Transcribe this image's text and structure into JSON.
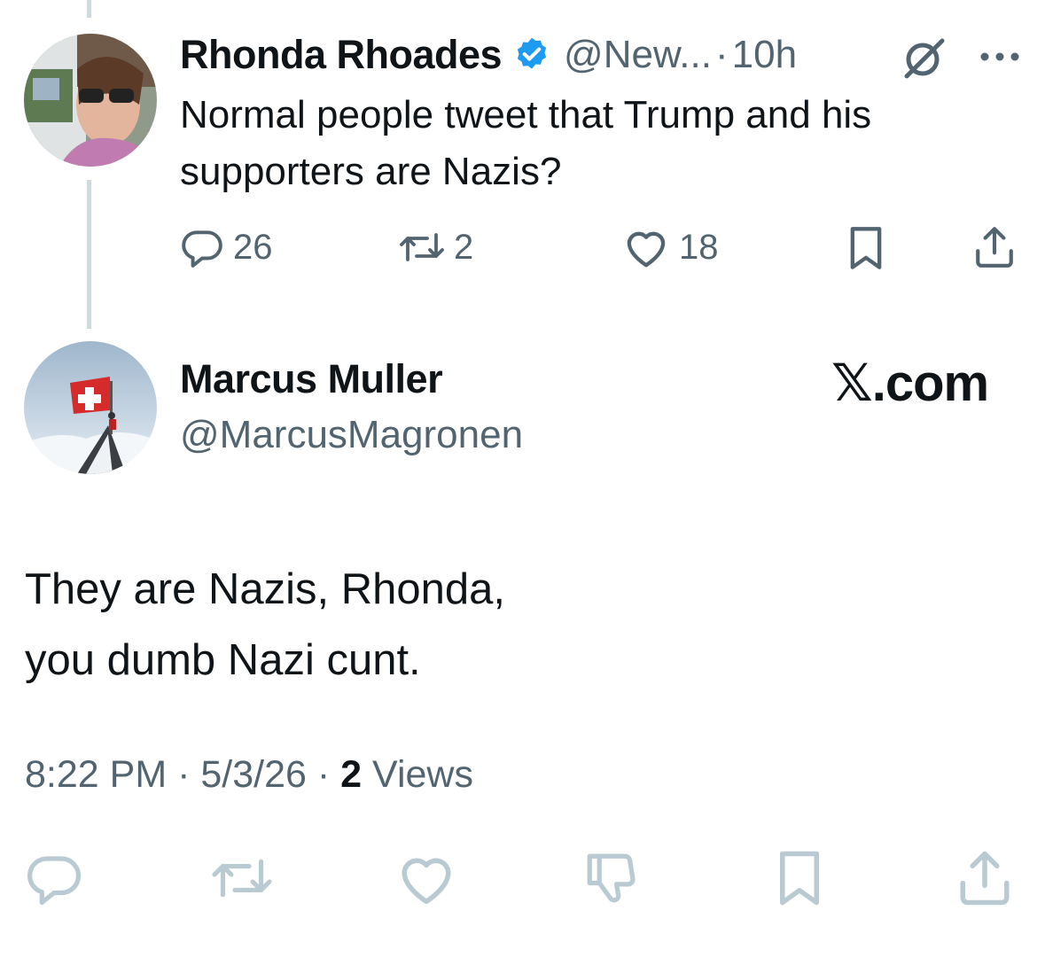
{
  "original_tweet": {
    "author_name": "Rhonda Rhoades",
    "handle": "@New...",
    "separator": "·",
    "time": "10h",
    "text_line1": "Normal people tweet that Trump and his",
    "text_line2": "supporters are Nazis?",
    "reply_count": "26",
    "repost_count": "2",
    "like_count": "18"
  },
  "reply": {
    "author_name": "Marcus Muller",
    "handle": "@MarcusMagronen",
    "text_line1": "They are Nazis, Rhonda,",
    "text_line2": "you dumb Nazi cunt.",
    "time": "8:22 PM",
    "date": "5/3/26",
    "views_count": "2",
    "views_label": "Views",
    "dot": "·"
  },
  "brand": "𝕏.com",
  "colors": {
    "verified_badge": "#1d9bf0",
    "secondary_text": "#536471",
    "primary_text": "#0f1419",
    "muted_icon": "#b9cad3"
  },
  "icons": [
    "verified-badge-icon",
    "grok-icon",
    "more-icon",
    "reply-icon",
    "repost-icon",
    "like-icon",
    "bookmark-icon",
    "share-icon",
    "dislike-icon"
  ]
}
